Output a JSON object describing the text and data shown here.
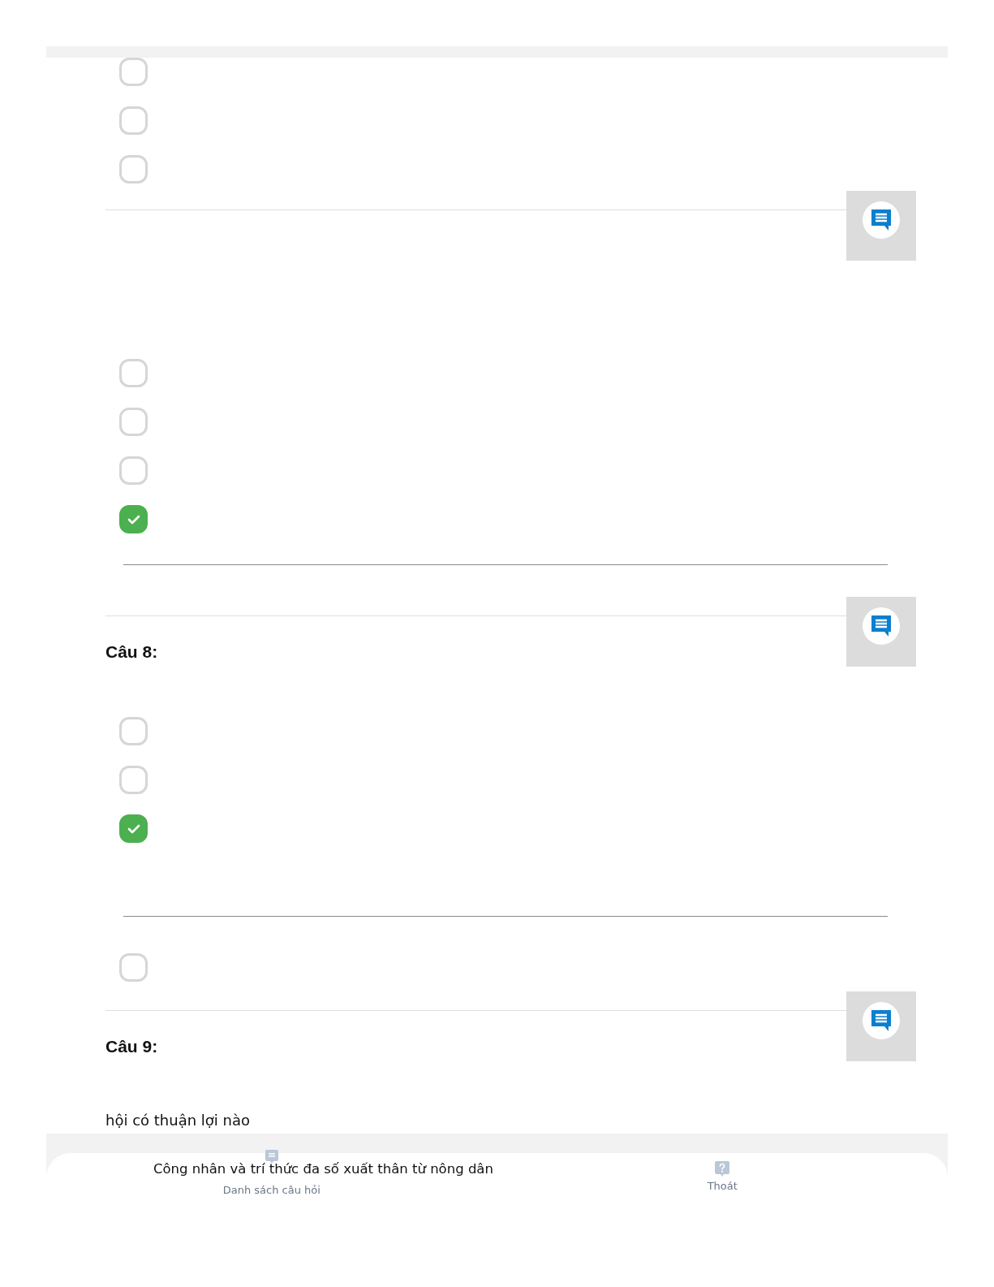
{
  "top_options": [
    {
      "checked": false
    },
    {
      "checked": false
    },
    {
      "checked": false
    }
  ],
  "questions": [
    {
      "blocks": [
        {
          "kind": "options",
          "options": [
            {
              "checked": false
            },
            {
              "checked": false
            },
            {
              "checked": false
            },
            {
              "checked": true
            }
          ]
        },
        {
          "kind": "rule"
        }
      ]
    },
    {
      "title": "Câu 8:",
      "blocks": [
        {
          "kind": "options",
          "options": [
            {
              "checked": false
            },
            {
              "checked": false
            },
            {
              "checked": true
            }
          ]
        },
        {
          "kind": "rule"
        },
        {
          "kind": "options",
          "options": [
            {
              "checked": false
            }
          ]
        }
      ]
    },
    {
      "title": "Câu 9:",
      "blocks": [
        {
          "kind": "text",
          "text": "hội có thuận lợi nào"
        }
      ]
    }
  ],
  "bottom_bar": {
    "overlay_text": "Công nhân và trí thức đa số xuất thân từ nông dân",
    "nav": [
      {
        "kind": "list",
        "label": "Danh sách câu hỏi"
      },
      {
        "kind": "help",
        "label": "Thoát"
      }
    ]
  }
}
